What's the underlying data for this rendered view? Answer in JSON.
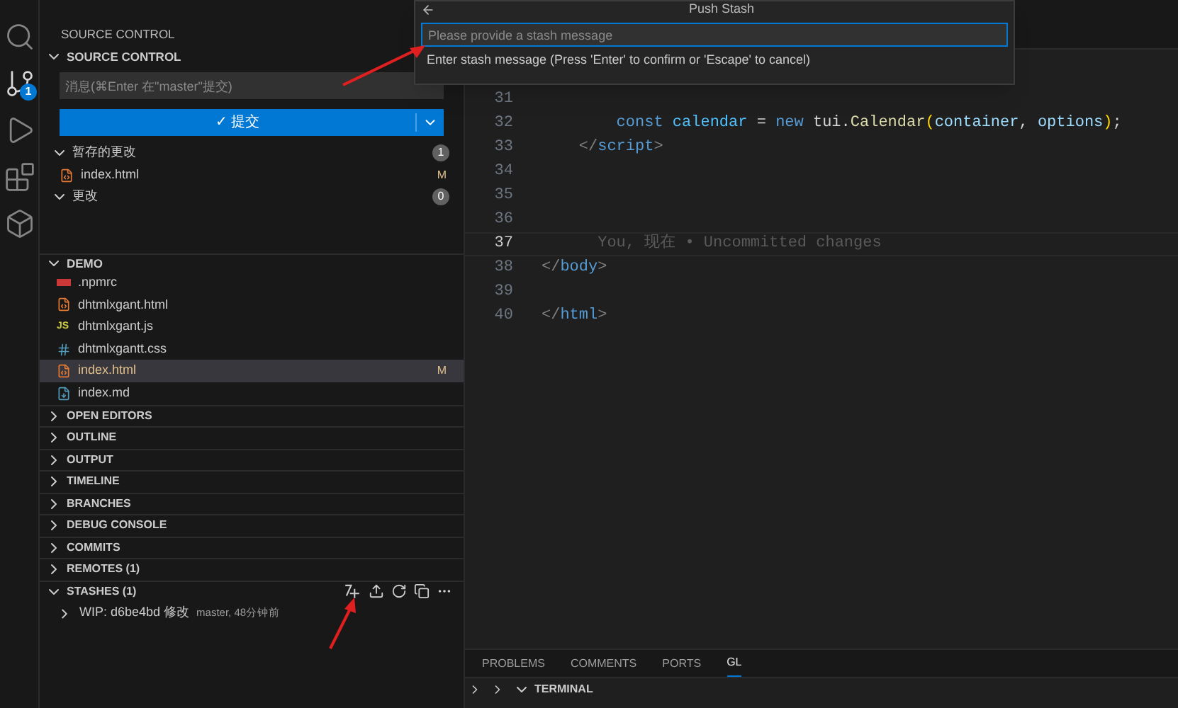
{
  "activity_bar": {
    "items": [
      {
        "kind": "search",
        "selected": false
      },
      {
        "kind": "source-control",
        "selected": true,
        "badge": "1"
      },
      {
        "kind": "run-debug",
        "selected": false
      },
      {
        "kind": "extensions",
        "selected": false
      },
      {
        "kind": "remote",
        "selected": false
      }
    ]
  },
  "sidebar": {
    "title": "SOURCE CONTROL",
    "section": "SOURCE CONTROL",
    "message_placeholder": "消息(⌘Enter 在\"master\"提交)",
    "commit_button": "✓ 提交",
    "groups": [
      {
        "label": "暂存的更改",
        "count": "1",
        "expanded": true,
        "files": [
          {
            "name": "index.html",
            "kind": "html",
            "status": "M"
          }
        ]
      },
      {
        "label": "更改",
        "count": "0",
        "expanded": true
      }
    ],
    "explorer": {
      "label": "DEMO",
      "expanded": true,
      "files": [
        {
          "name": ".npmrc",
          "kind": "npm",
          "selected": false
        },
        {
          "name": "dhtmlxgant.html",
          "kind": "html",
          "selected": false
        },
        {
          "name": "dhtmlxgant.js",
          "kind": "js",
          "icon_text": "JS",
          "selected": false
        },
        {
          "name": "dhtmlxgantt.css",
          "kind": "css",
          "selected": false
        },
        {
          "name": "index.html",
          "kind": "html",
          "status": "M",
          "selected": true
        },
        {
          "name": "index.md",
          "kind": "md",
          "selected": false
        }
      ]
    },
    "panels": [
      {
        "label": "OPEN EDITORS",
        "expanded": false
      },
      {
        "label": "OUTLINE",
        "expanded": false
      },
      {
        "label": "OUTPUT",
        "expanded": false
      },
      {
        "label": "TIMELINE",
        "expanded": false
      },
      {
        "label": "BRANCHES",
        "expanded": false
      },
      {
        "label": "DEBUG CONSOLE",
        "expanded": false
      },
      {
        "label": "COMMITS",
        "expanded": false
      },
      {
        "label": "REMOTES (1)",
        "expanded": false
      },
      {
        "label": "STASHES (1)",
        "expanded": true
      }
    ],
    "stashes": [
      {
        "title": "WIP: d6be4bd 修改",
        "detail": "master, 48分钟前"
      }
    ]
  },
  "quick_input": {
    "title": "Push Stash",
    "placeholder": "Please provide a stash message",
    "hint": "Enter stash message (Press 'Enter' to confirm or 'Escape' to cancel)"
  },
  "editor": {
    "lines": [
      {
        "number": "31",
        "current": false
      },
      {
        "number": "32",
        "current": false,
        "tokens": [
          {
            "text": "        const",
            "kind": "keyword"
          },
          {
            "text": " calendar",
            "kind": "const"
          },
          {
            "text": " = ",
            "kind": "plain"
          },
          {
            "text": "new",
            "kind": "keyword"
          },
          {
            "text": " tui.",
            "kind": "plain"
          },
          {
            "text": "Calendar",
            "kind": "function"
          },
          {
            "text": "(",
            "kind": "bracket"
          },
          {
            "text": "container",
            "kind": "variable"
          },
          {
            "text": ", ",
            "kind": "plain"
          },
          {
            "text": "options",
            "kind": "variable"
          },
          {
            "text": ")",
            "kind": "bracket"
          },
          {
            "text": ";",
            "kind": "plain"
          }
        ]
      },
      {
        "number": "33",
        "current": false,
        "tokens": [
          {
            "text": "    </",
            "kind": "punct"
          },
          {
            "text": "script",
            "kind": "tag"
          },
          {
            "text": ">",
            "kind": "punct"
          }
        ]
      },
      {
        "number": "34",
        "current": false
      },
      {
        "number": "35",
        "current": false
      },
      {
        "number": "36",
        "current": false
      },
      {
        "number": "37",
        "current": true,
        "tokens": [
          {
            "text": "      You, 现在 • Uncommitted changes",
            "kind": "ghost"
          }
        ]
      },
      {
        "number": "38",
        "current": false,
        "tokens": [
          {
            "text": "</",
            "kind": "punct"
          },
          {
            "text": "body",
            "kind": "tag"
          },
          {
            "text": ">",
            "kind": "punct"
          }
        ]
      },
      {
        "number": "39",
        "current": false
      },
      {
        "number": "40",
        "current": false,
        "tokens": [
          {
            "text": "</",
            "kind": "punct"
          },
          {
            "text": "html",
            "kind": "tag"
          },
          {
            "text": ">",
            "kind": "punct"
          }
        ]
      }
    ]
  },
  "bottom_panel": {
    "tabs": [
      {
        "label": "PROBLEMS",
        "selected": false
      },
      {
        "label": "COMMENTS",
        "selected": false
      },
      {
        "label": "PORTS",
        "selected": false
      },
      {
        "label": "GL",
        "selected": true
      }
    ],
    "terminal": {
      "label": "TERMINAL",
      "expanded": true
    }
  }
}
